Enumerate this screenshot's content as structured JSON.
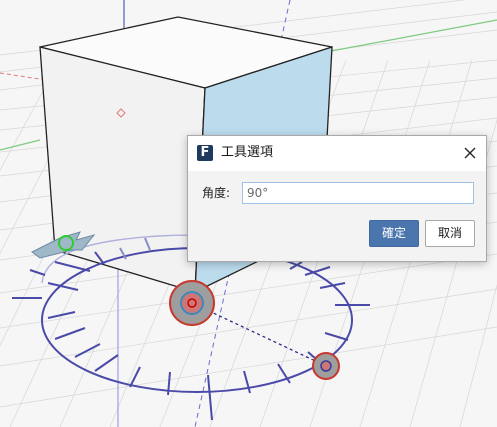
{
  "dialog": {
    "title": "工具選項",
    "app_icon_letter": "F",
    "angle_label": "角度:",
    "angle_value": "90°",
    "ok_label": "確定",
    "cancel_label": "取消"
  },
  "colors": {
    "cube_face_selected": "#bcdcee",
    "dial_color": "#4a4aa8",
    "grid_line": "#d5d5d5",
    "primary_button": "#4a75ad"
  },
  "icons": [
    "close-icon",
    "app-icon",
    "rotate-arrow-icon"
  ]
}
